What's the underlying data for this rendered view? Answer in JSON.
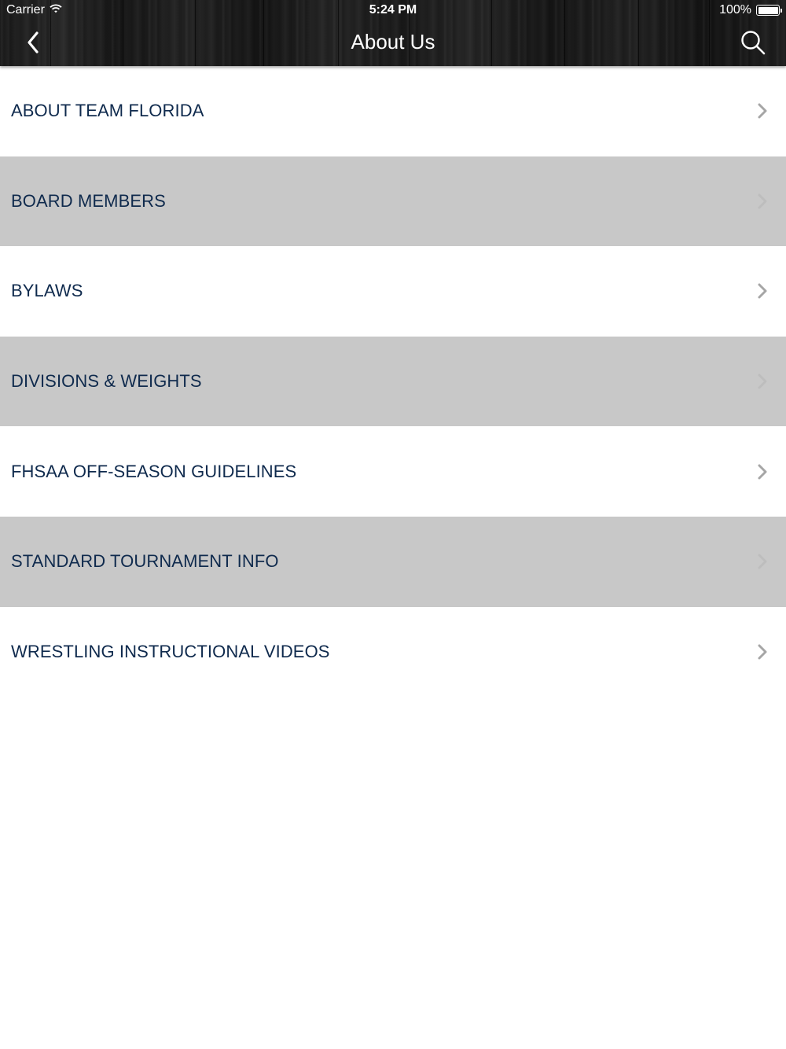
{
  "status_bar": {
    "carrier": "Carrier",
    "time": "5:24 PM",
    "battery": "100%",
    "battery_level": 1.0
  },
  "nav": {
    "title": "About Us",
    "back_icon": "chevron-left-icon",
    "search_icon": "search-icon"
  },
  "menu": {
    "items": [
      {
        "label": "ABOUT TEAM FLORIDA"
      },
      {
        "label": "BOARD MEMBERS"
      },
      {
        "label": "BYLAWS"
      },
      {
        "label": "DIVISIONS & WEIGHTS"
      },
      {
        "label": "FHSAA OFF-SEASON GUIDELINES"
      },
      {
        "label": "STANDARD TOURNAMENT INFO"
      },
      {
        "label": "WRESTLING INSTRUCTIONAL VIDEOS"
      }
    ]
  },
  "colors": {
    "label_text": "#0f2a4d",
    "alt_row": "#c8c8c8",
    "chevron_on_white": "#a6a6a6",
    "chevron_on_gray": "#bdbdbd",
    "nav_background": "#1a1a1a"
  }
}
